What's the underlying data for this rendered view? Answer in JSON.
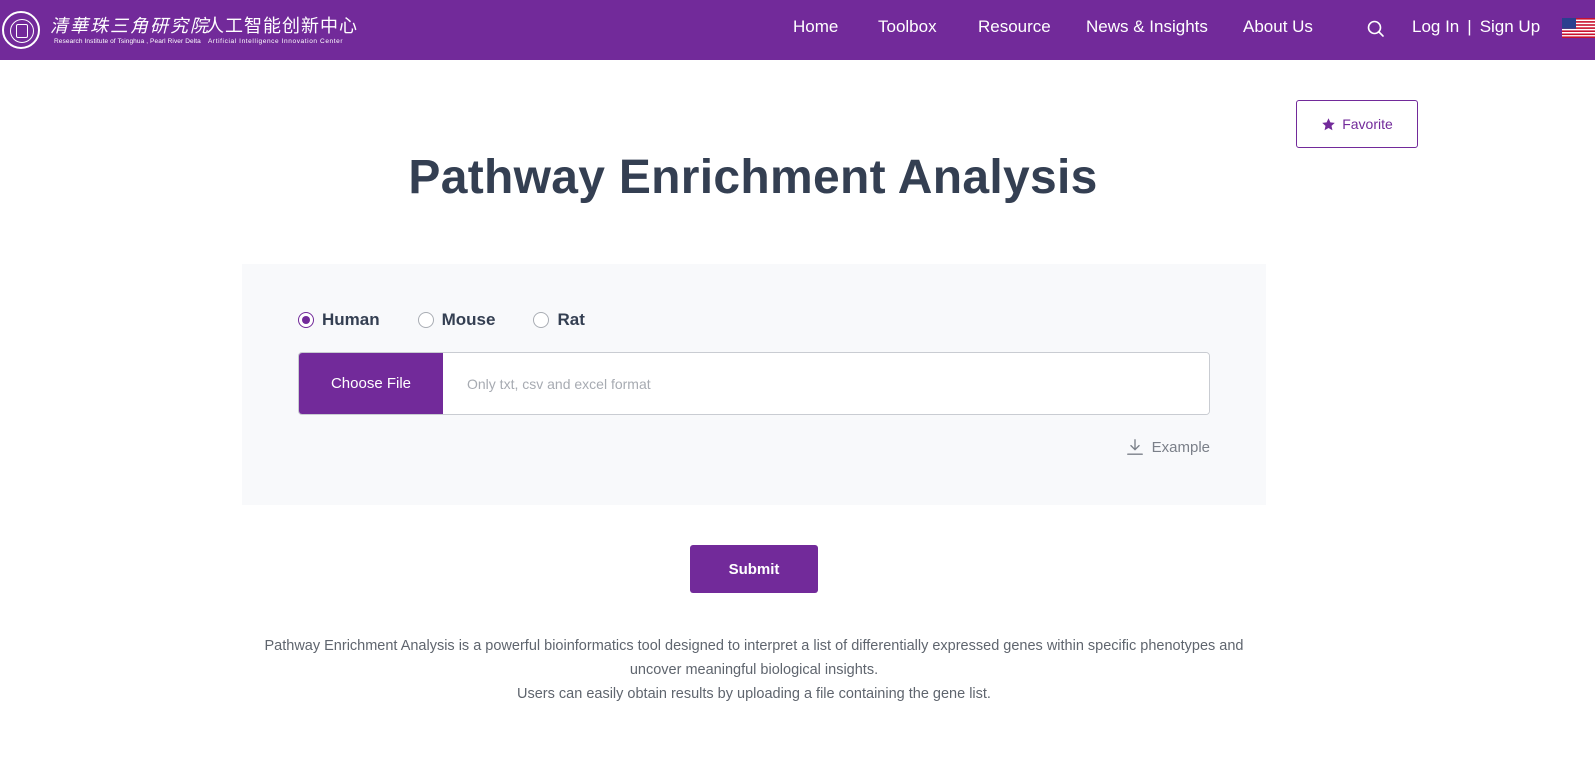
{
  "header": {
    "logo": {
      "cn_name": "清華珠三角研究院",
      "cn_center": "人工智能创新中心",
      "en_name": "Research Institute of Tsinghua , Pearl River Delta",
      "en_center": "Artificial Intelligence Innovation Center"
    },
    "nav": [
      "Home",
      "Toolbox",
      "Resource",
      "News & Insights",
      "About Us"
    ],
    "auth": {
      "login": "Log In",
      "separator": "|",
      "signup": "Sign Up"
    },
    "icons": {
      "search": "search-icon",
      "language": "us-flag-icon"
    },
    "colors": {
      "brand": "#722a9a"
    }
  },
  "favorite": {
    "label": "Favorite",
    "icon": "star-icon"
  },
  "page": {
    "title": "Pathway Enrichment Analysis"
  },
  "form": {
    "species": [
      {
        "label": "Human",
        "checked": true
      },
      {
        "label": "Mouse",
        "checked": false
      },
      {
        "label": "Rat",
        "checked": false
      }
    ],
    "choose_file_label": "Choose File",
    "file_placeholder": "Only txt, csv and excel format",
    "example_label": "Example",
    "example_icon": "download-icon"
  },
  "submit_label": "Submit",
  "description": {
    "line1": "Pathway Enrichment Analysis is a powerful bioinformatics tool designed to interpret a list of differentially expressed genes within specific phenotypes and uncover meaningful biological insights.",
    "line2": "Users can easily obtain results by uploading a file containing the gene list."
  }
}
